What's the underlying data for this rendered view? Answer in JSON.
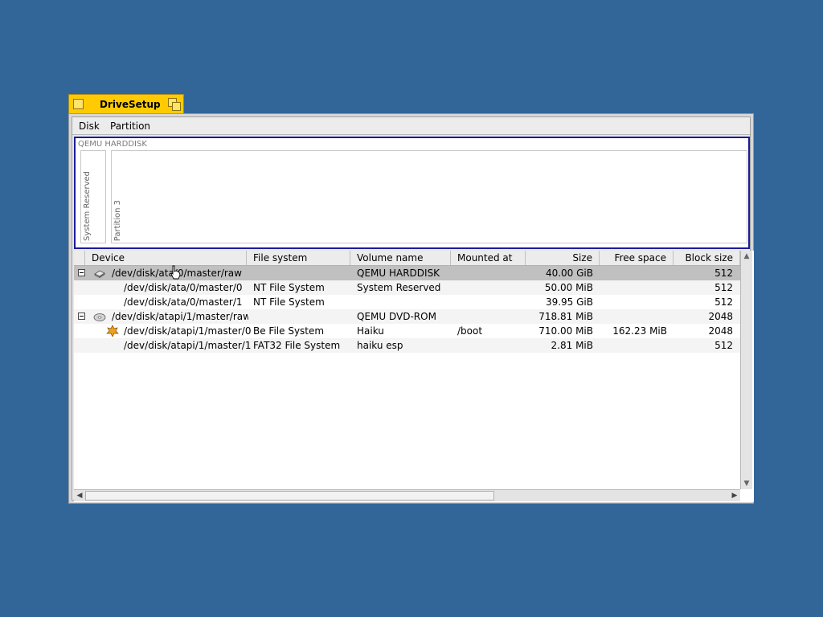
{
  "window": {
    "title": "DriveSetup"
  },
  "menubar": {
    "items": [
      "Disk",
      "Partition"
    ]
  },
  "diskmap": {
    "disk_label": "QEMU HARDDISK",
    "partitions": [
      "System Reserved",
      "Partition 3"
    ]
  },
  "list": {
    "columns": [
      "Device",
      "File system",
      "Volume name",
      "Mounted at",
      "Size",
      "Free space",
      "Block size"
    ],
    "rows": [
      {
        "device": "/dev/disk/ata/0/master/raw",
        "fs": "",
        "volume": "QEMU HARDDISK",
        "mount": "",
        "size": "40.00 GiB",
        "free": "",
        "block": "512",
        "icon": "harddisk-icon"
      },
      {
        "device": "/dev/disk/ata/0/master/0",
        "fs": "NT File System",
        "volume": "System Reserved",
        "mount": "",
        "size": "50.00 MiB",
        "free": "",
        "block": "512"
      },
      {
        "device": "/dev/disk/ata/0/master/1",
        "fs": "NT File System",
        "volume": "",
        "mount": "",
        "size": "39.95 GiB",
        "free": "",
        "block": "512"
      },
      {
        "device": "/dev/disk/atapi/1/master/raw",
        "fs": "",
        "volume": "QEMU DVD-ROM",
        "mount": "",
        "size": "718.81 MiB",
        "free": "",
        "block": "2048",
        "icon": "cdrom-icon"
      },
      {
        "device": "/dev/disk/atapi/1/master/0",
        "fs": "Be File System",
        "volume": "Haiku",
        "mount": "/boot",
        "size": "710.00 MiB",
        "free": "162.23 MiB",
        "block": "2048",
        "icon": "haiku-leaf-icon"
      },
      {
        "device": "/dev/disk/atapi/1/master/1",
        "fs": "FAT32 File System",
        "volume": "haiku esp",
        "mount": "",
        "size": "2.81 MiB",
        "free": "",
        "block": "512"
      }
    ]
  },
  "colors": {
    "desktop": "#336698",
    "tab": "#ffcb00",
    "selection_border": "#1b1b9a"
  }
}
